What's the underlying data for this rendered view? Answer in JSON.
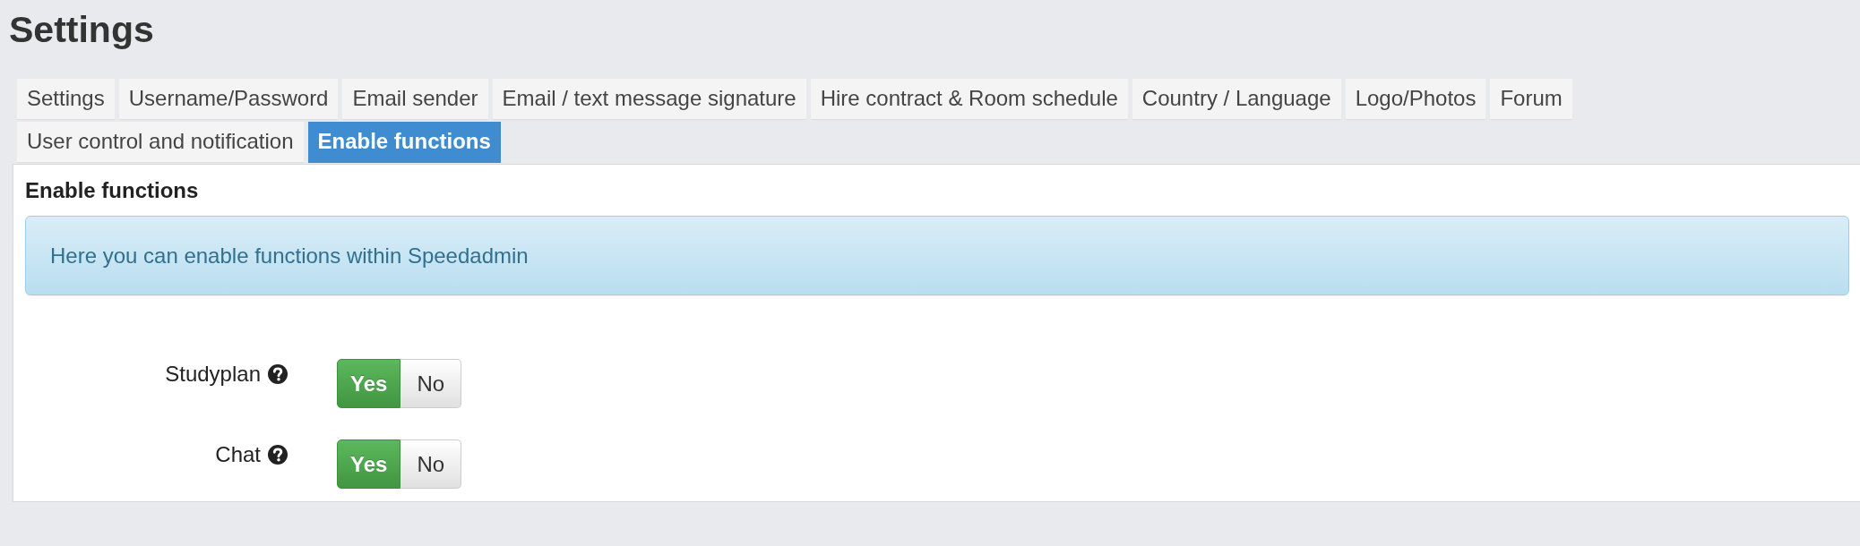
{
  "page": {
    "title": "Settings"
  },
  "tabs": [
    {
      "label": "Settings",
      "selected": false
    },
    {
      "label": "Username/Password",
      "selected": false
    },
    {
      "label": "Email sender",
      "selected": false
    },
    {
      "label": "Email / text message signature",
      "selected": false
    },
    {
      "label": "Hire contract & Room schedule",
      "selected": false
    },
    {
      "label": "Country / Language",
      "selected": false
    },
    {
      "label": "Logo/Photos",
      "selected": false
    },
    {
      "label": "Forum",
      "selected": false
    },
    {
      "label": "User control and notification",
      "selected": false
    },
    {
      "label": "Enable functions",
      "selected": true
    }
  ],
  "panel": {
    "heading": "Enable functions",
    "info": "Here you can enable functions within Speedadmin"
  },
  "settings": [
    {
      "label": "Studyplan",
      "options": [
        {
          "label": "Yes",
          "selected": true
        },
        {
          "label": "No",
          "selected": false
        }
      ]
    },
    {
      "label": "Chat",
      "options": [
        {
          "label": "Yes",
          "selected": true
        },
        {
          "label": "No",
          "selected": false
        }
      ]
    }
  ]
}
